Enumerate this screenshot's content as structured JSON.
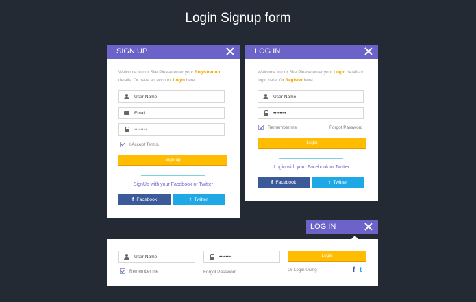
{
  "page": {
    "title": "Login Signup form"
  },
  "colors": {
    "header": "#6c63c9",
    "accent": "#ffbc00",
    "highlight": "#f0a500",
    "facebook": "#3b5a9a",
    "twitter": "#1fa8e6",
    "background": "#232a33"
  },
  "signup": {
    "title": "SIGN UP",
    "welcome_pre": "Welcome to our Site.Please enter your ",
    "welcome_hl1": "Registration",
    "welcome_mid": " details. Or have an account ",
    "welcome_hl2": "Login",
    "welcome_post": " here",
    "username_placeholder": "User Name",
    "email_placeholder": "Email",
    "password_value": "••••••••",
    "terms_label": "I Accept Terms.",
    "submit_label": "Sign up",
    "social_text": "SignUp with your Facebook or Twitter",
    "facebook_label": "Facebook",
    "twitter_label": "Twitter"
  },
  "login": {
    "title": "LOG IN",
    "welcome_pre": "Welcome to our Site.Please enter your ",
    "welcome_hl1": "Login",
    "welcome_mid": " details to login here. Or ",
    "welcome_hl2": "Register",
    "welcome_post": " here.",
    "username_placeholder": "User Name",
    "password_value": "••••••••",
    "remember_label": "Remember me",
    "forgot_label": "Forgot Password",
    "submit_label": "Login",
    "social_text": "Login with your Facebook or Twitter",
    "facebook_label": "Facebook",
    "twitter_label": "Twitter"
  },
  "login_bar": {
    "title": "LOG IN",
    "username_placeholder": "User Name",
    "password_value": "••••••••",
    "remember_label": "Remember me",
    "forgot_label": "Forgot Password",
    "submit_label": "Login",
    "or_login_label": "Or Login Using",
    "facebook_glyph": "f",
    "twitter_glyph": "🐦"
  },
  "icons": {
    "facebook": "f",
    "twitter": "t"
  }
}
